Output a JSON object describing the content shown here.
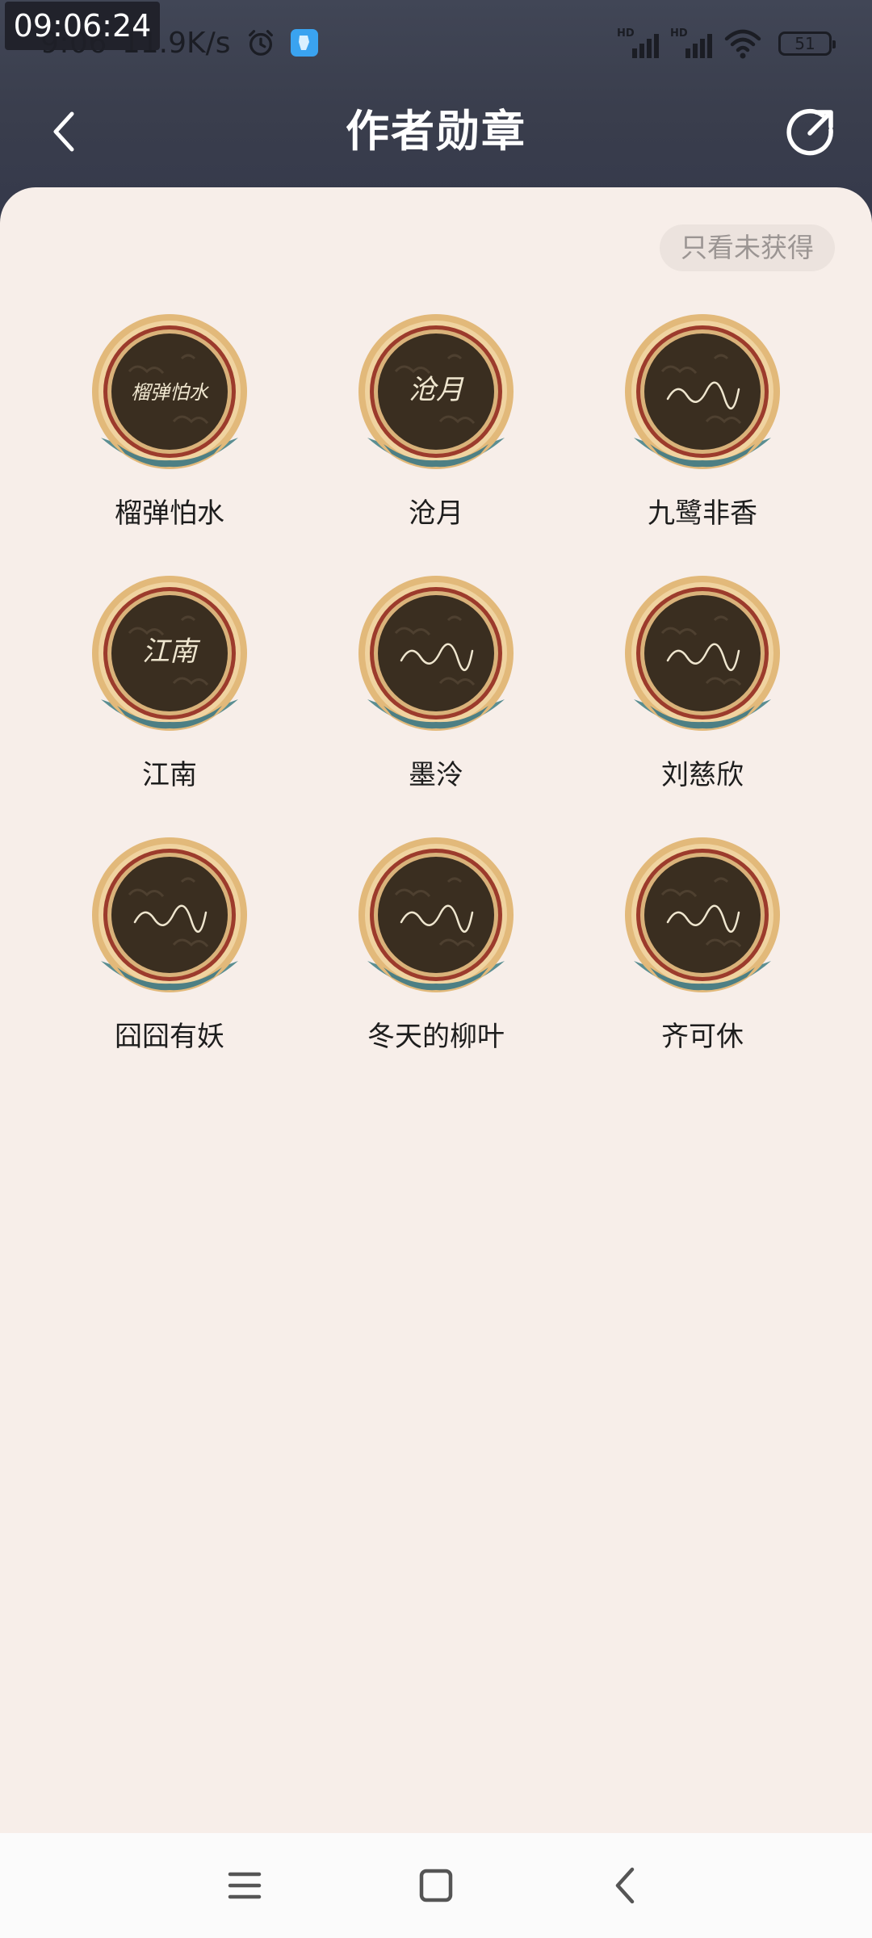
{
  "status_bar": {
    "time": "9:06",
    "speed": "11.9K/s",
    "time_overlay": "09:06:24",
    "network_1": "HD",
    "network_2": "HD",
    "battery": "51"
  },
  "header": {
    "title": "作者勋章"
  },
  "filter": {
    "label": "只看未获得"
  },
  "badges": [
    {
      "name": "榴弹怕水",
      "signature": "榴弹怕水"
    },
    {
      "name": "沧月",
      "signature": "沧月"
    },
    {
      "name": "九鹭非香",
      "signature": ""
    },
    {
      "name": "江南",
      "signature": "江南"
    },
    {
      "name": "墨泠",
      "signature": ""
    },
    {
      "name": "刘慈欣",
      "signature": ""
    },
    {
      "name": "囧囧有妖",
      "signature": ""
    },
    {
      "name": "冬天的柳叶",
      "signature": ""
    },
    {
      "name": "齐可休",
      "signature": ""
    }
  ],
  "icons": {
    "back": "chevron-left-icon",
    "share": "share-icon",
    "menu": "menu-icon",
    "home": "home-icon",
    "nav_back": "nav-back-icon"
  },
  "colors": {
    "header_bg": "#3a3e4d",
    "card_bg": "#f7eee9",
    "medal_gold": "#e2b97a",
    "medal_center": "#3a2e20",
    "medal_ribbon": "#5a8e92"
  }
}
